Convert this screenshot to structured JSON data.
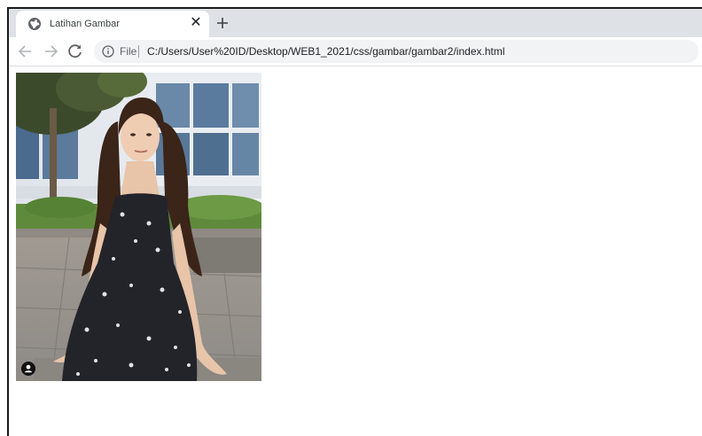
{
  "browser": {
    "tab": {
      "title": "Latihan Gambar",
      "favicon_icon": "globe-icon",
      "close_icon": "close-icon"
    },
    "new_tab_icon": "plus-icon",
    "toolbar": {
      "back_icon": "arrow-left-icon",
      "forward_icon": "arrow-right-icon",
      "reload_icon": "reload-icon",
      "site_info_icon": "info-icon",
      "scheme_label": "File",
      "url": "C:/Users/User%20ID/Desktop/WEB1_2021/css/gambar/gambar2/index.html"
    }
  },
  "page": {
    "image": {
      "description_icon": "photo",
      "badge_icon": "person-icon"
    }
  },
  "colors": {
    "tabstrip": "#dee1e6",
    "omnibox": "#f1f3f4",
    "frame_border": "#1a1a1a"
  }
}
